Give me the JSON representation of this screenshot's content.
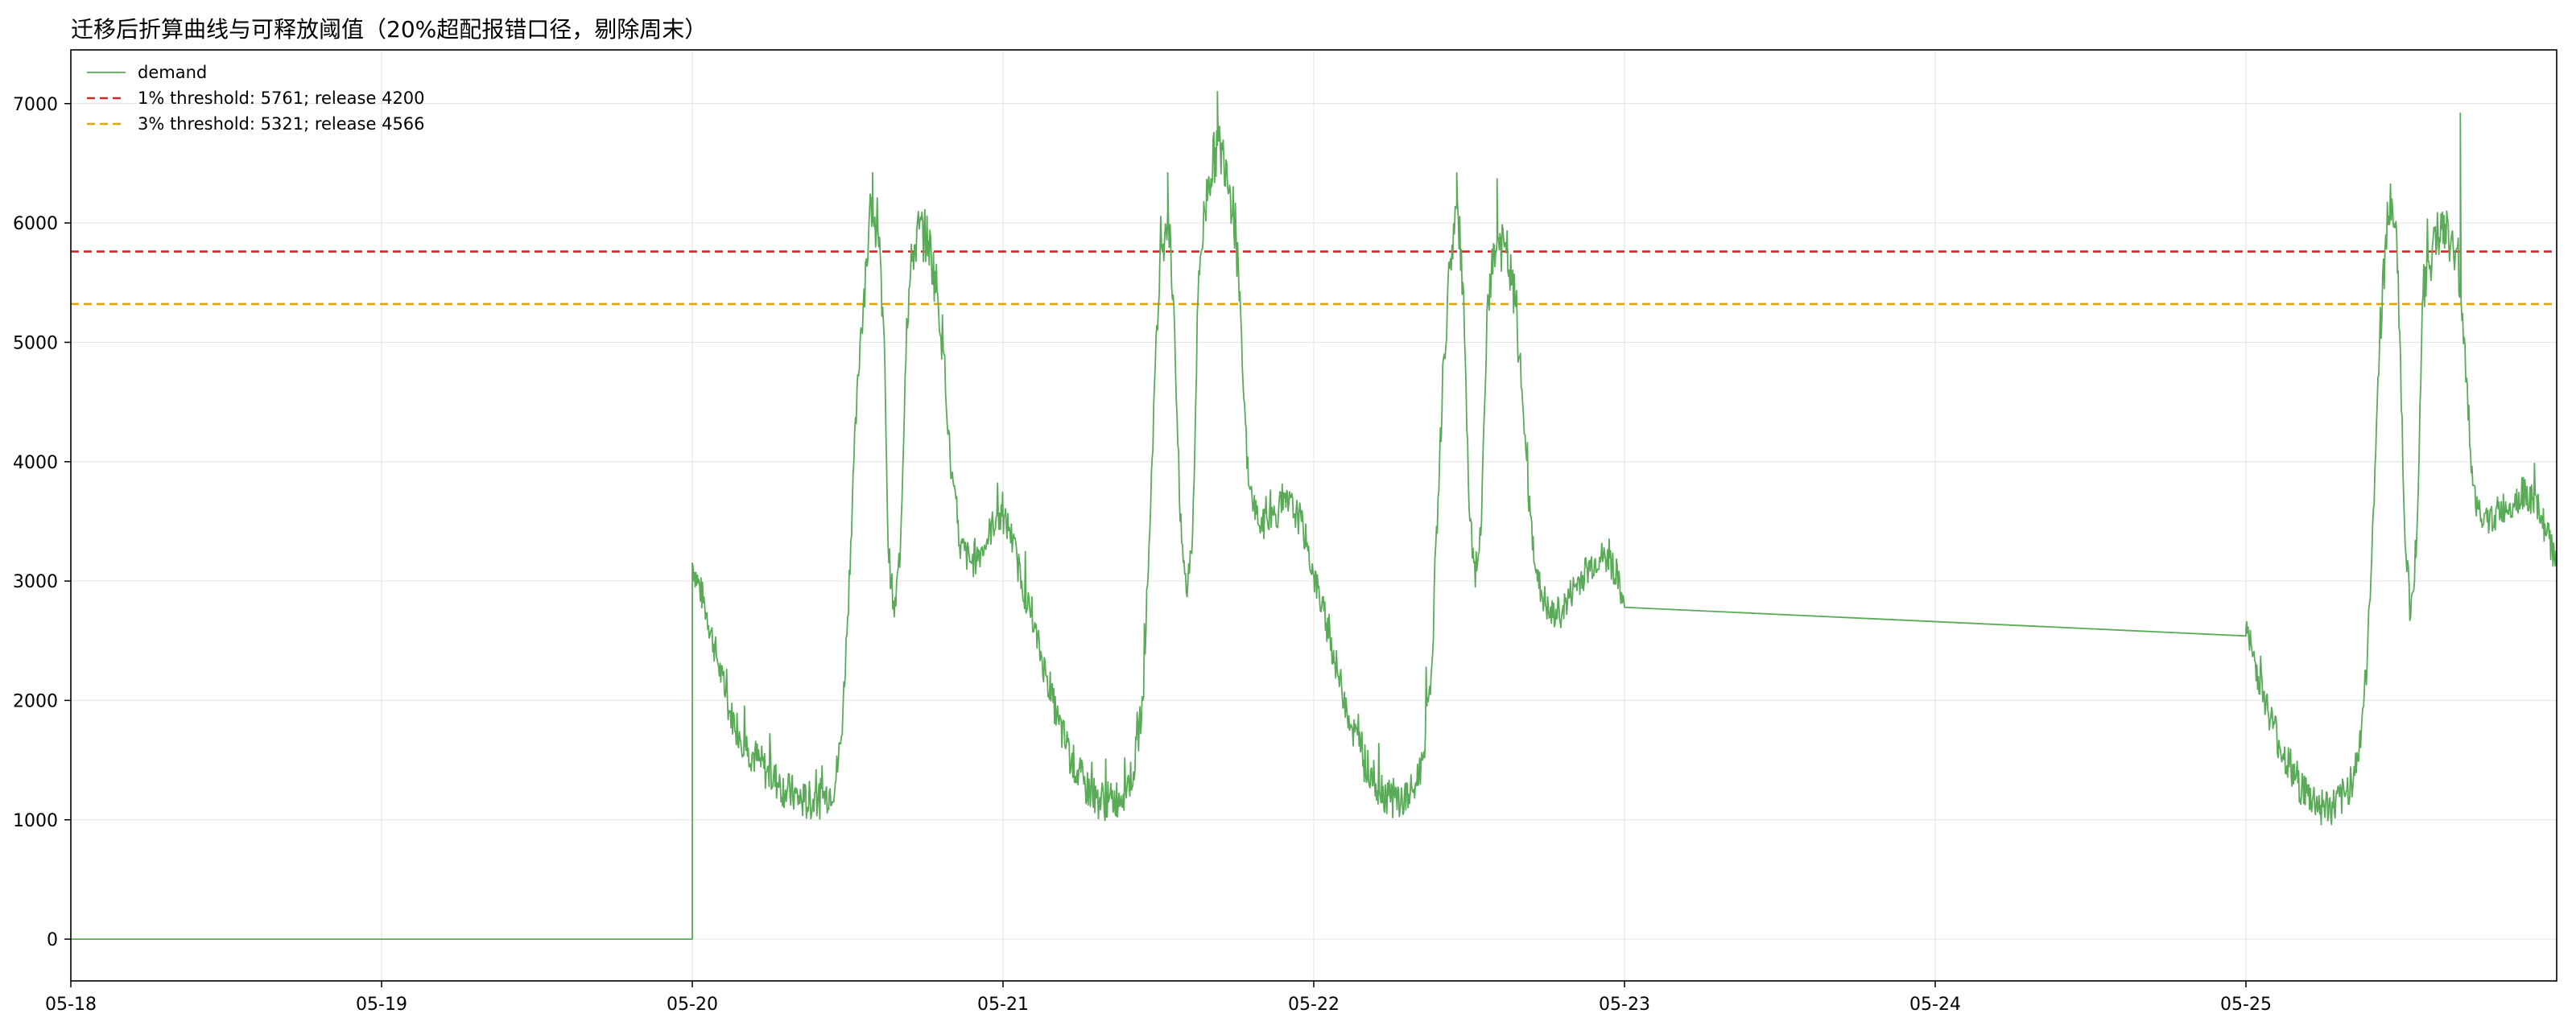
{
  "chart_data": {
    "type": "line",
    "title": "迁移后折算曲线与可释放阈值（20%超配报错口径，剔除周末）",
    "xlabel": "",
    "ylabel": "",
    "x_ticks": [
      "05-18",
      "05-19",
      "05-20",
      "05-21",
      "05-22",
      "05-23",
      "05-24",
      "05-25"
    ],
    "y_ticks": [
      0,
      1000,
      2000,
      3000,
      4000,
      5000,
      6000,
      7000
    ],
    "xlim": [
      0,
      8.0
    ],
    "ylim": [
      -350,
      7450
    ],
    "grid": true,
    "legend_position": "top-left",
    "series": [
      {
        "name": "demand",
        "color": "#5aab57",
        "style": "solid",
        "points": [
          [
            0,
            0
          ],
          [
            2.0,
            0
          ],
          [
            2.0,
            3150
          ],
          [
            2.04,
            2800
          ],
          [
            2.08,
            2350
          ],
          [
            2.12,
            1900
          ],
          [
            2.18,
            1600
          ],
          [
            2.24,
            1400
          ],
          [
            2.3,
            1250
          ],
          [
            2.36,
            1150
          ],
          [
            2.42,
            1180
          ],
          [
            2.46,
            1300
          ],
          [
            2.48,
            1700
          ],
          [
            2.5,
            2700
          ],
          [
            2.52,
            4000
          ],
          [
            2.54,
            5000
          ],
          [
            2.56,
            5700
          ],
          [
            2.58,
            6150
          ],
          [
            2.6,
            5800
          ],
          [
            2.62,
            4800
          ],
          [
            2.63,
            3300
          ],
          [
            2.65,
            2700
          ],
          [
            2.67,
            3300
          ],
          [
            2.69,
            5200
          ],
          [
            2.71,
            5750
          ],
          [
            2.73,
            5950
          ],
          [
            2.76,
            5850
          ],
          [
            2.79,
            5400
          ],
          [
            2.81,
            4900
          ],
          [
            2.83,
            4000
          ],
          [
            2.86,
            3300
          ],
          [
            2.9,
            3150
          ],
          [
            2.94,
            3300
          ],
          [
            2.98,
            3550
          ],
          [
            3.02,
            3450
          ],
          [
            3.06,
            3000
          ],
          [
            3.1,
            2600
          ],
          [
            3.14,
            2200
          ],
          [
            3.18,
            1800
          ],
          [
            3.22,
            1500
          ],
          [
            3.26,
            1300
          ],
          [
            3.3,
            1180
          ],
          [
            3.34,
            1150
          ],
          [
            3.38,
            1200
          ],
          [
            3.42,
            1400
          ],
          [
            3.45,
            2000
          ],
          [
            3.47,
            3300
          ],
          [
            3.49,
            4800
          ],
          [
            3.51,
            5800
          ],
          [
            3.53,
            6100
          ],
          [
            3.55,
            5300
          ],
          [
            3.57,
            3500
          ],
          [
            3.59,
            2900
          ],
          [
            3.61,
            3400
          ],
          [
            3.63,
            5600
          ],
          [
            3.66,
            6350
          ],
          [
            3.69,
            6650
          ],
          [
            3.72,
            6500
          ],
          [
            3.75,
            5900
          ],
          [
            3.77,
            4800
          ],
          [
            3.79,
            3800
          ],
          [
            3.83,
            3450
          ],
          [
            3.87,
            3550
          ],
          [
            3.92,
            3650
          ],
          [
            3.96,
            3500
          ],
          [
            4.0,
            3050
          ],
          [
            4.04,
            2650
          ],
          [
            4.08,
            2200
          ],
          [
            4.12,
            1800
          ],
          [
            4.16,
            1500
          ],
          [
            4.2,
            1300
          ],
          [
            4.24,
            1200
          ],
          [
            4.28,
            1150
          ],
          [
            4.32,
            1230
          ],
          [
            4.35,
            1500
          ],
          [
            4.38,
            2300
          ],
          [
            4.4,
            3700
          ],
          [
            4.42,
            4900
          ],
          [
            4.44,
            5700
          ],
          [
            4.46,
            6150
          ],
          [
            4.48,
            5500
          ],
          [
            4.5,
            3600
          ],
          [
            4.52,
            2950
          ],
          [
            4.54,
            3500
          ],
          [
            4.56,
            5400
          ],
          [
            4.59,
            5850
          ],
          [
            4.62,
            5750
          ],
          [
            4.65,
            5300
          ],
          [
            4.67,
            4600
          ],
          [
            4.69,
            3700
          ],
          [
            4.72,
            3000
          ],
          [
            4.76,
            2700
          ],
          [
            4.8,
            2750
          ],
          [
            4.84,
            2950
          ],
          [
            4.88,
            3100
          ],
          [
            4.92,
            3200
          ],
          [
            4.96,
            3150
          ],
          [
            5.0,
            2780
          ],
          [
            7.0,
            2540
          ],
          [
            7.0,
            2600
          ],
          [
            7.04,
            2200
          ],
          [
            7.08,
            1850
          ],
          [
            7.12,
            1550
          ],
          [
            7.16,
            1350
          ],
          [
            7.2,
            1200
          ],
          [
            7.24,
            1120
          ],
          [
            7.28,
            1100
          ],
          [
            7.32,
            1200
          ],
          [
            7.36,
            1500
          ],
          [
            7.39,
            2300
          ],
          [
            7.41,
            3600
          ],
          [
            7.43,
            5000
          ],
          [
            7.45,
            5900
          ],
          [
            7.47,
            6200
          ],
          [
            7.49,
            5600
          ],
          [
            7.51,
            3500
          ],
          [
            7.53,
            2700
          ],
          [
            7.55,
            3400
          ],
          [
            7.57,
            5400
          ],
          [
            7.6,
            5800
          ],
          [
            7.63,
            5950
          ],
          [
            7.66,
            5850
          ],
          [
            7.69,
            5500
          ],
          [
            7.71,
            4700
          ],
          [
            7.73,
            3800
          ],
          [
            7.76,
            3450
          ],
          [
            7.8,
            3550
          ],
          [
            7.85,
            3650
          ],
          [
            7.9,
            3750
          ],
          [
            7.95,
            3550
          ],
          [
            8.0,
            3150
          ]
        ]
      },
      {
        "name": "1% threshold: 5761; release 4200",
        "color": "#d62728",
        "style": "dashed",
        "value": 5761
      },
      {
        "name": "3% threshold: 5321; release 4566",
        "color": "#e8a400",
        "style": "dashed",
        "value": 5321
      }
    ],
    "spikes": [
      [
        3.69,
        7100
      ],
      [
        7.69,
        6920
      ],
      [
        4.46,
        6420
      ],
      [
        2.58,
        6420
      ],
      [
        3.53,
        6420
      ],
      [
        4.59,
        6370
      ]
    ]
  }
}
